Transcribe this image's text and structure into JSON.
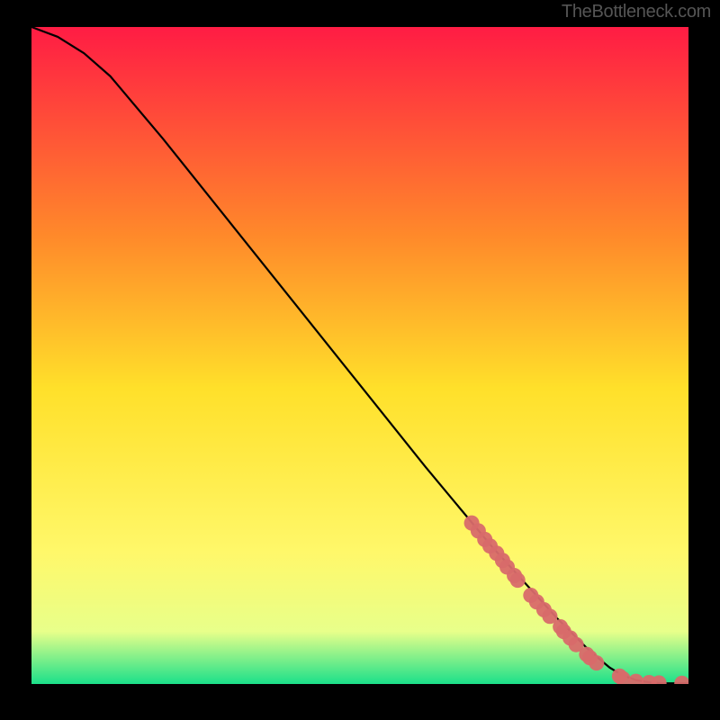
{
  "watermark": "TheBottleneck.com",
  "colors": {
    "frame": "#000000",
    "gradient_top": "#ff1c44",
    "gradient_mid1": "#ff8a2a",
    "gradient_mid2": "#ffe02a",
    "gradient_mid3": "#fff86a",
    "gradient_mid4": "#e8ff8a",
    "gradient_bot": "#1be08a",
    "curve": "#000000",
    "markers": "#d86a6a"
  },
  "chart_data": {
    "type": "line",
    "title": "",
    "xlabel": "",
    "ylabel": "",
    "xlim": [
      0,
      100
    ],
    "ylim": [
      0,
      100
    ],
    "series": [
      {
        "name": "curve",
        "x": [
          0,
          4,
          8,
          12,
          20,
          30,
          40,
          50,
          60,
          70,
          80,
          85,
          88,
          90,
          92,
          94,
          96,
          100
        ],
        "y": [
          100,
          98.5,
          96,
          92.5,
          83,
          70.5,
          58,
          45.5,
          33,
          21,
          10,
          5,
          2.5,
          1.3,
          0.6,
          0.25,
          0.1,
          0.1
        ]
      }
    ],
    "markers": [
      {
        "x": 67,
        "y": 24.5
      },
      {
        "x": 68,
        "y": 23.3
      },
      {
        "x": 69,
        "y": 22.0
      },
      {
        "x": 69.8,
        "y": 21.0
      },
      {
        "x": 70.8,
        "y": 19.9
      },
      {
        "x": 71.7,
        "y": 18.8
      },
      {
        "x": 72.4,
        "y": 17.8
      },
      {
        "x": 73.5,
        "y": 16.5
      },
      {
        "x": 74.0,
        "y": 15.8
      },
      {
        "x": 76.0,
        "y": 13.5
      },
      {
        "x": 76.9,
        "y": 12.5
      },
      {
        "x": 78.0,
        "y": 11.3
      },
      {
        "x": 78.9,
        "y": 10.3
      },
      {
        "x": 80.5,
        "y": 8.7
      },
      {
        "x": 81.0,
        "y": 8.0
      },
      {
        "x": 82.0,
        "y": 7.0
      },
      {
        "x": 82.9,
        "y": 6.0
      },
      {
        "x": 84.5,
        "y": 4.5
      },
      {
        "x": 85.0,
        "y": 4.0
      },
      {
        "x": 86.0,
        "y": 3.2
      },
      {
        "x": 89.5,
        "y": 1.2
      },
      {
        "x": 90.0,
        "y": 0.8
      },
      {
        "x": 92.0,
        "y": 0.4
      },
      {
        "x": 94.0,
        "y": 0.2
      },
      {
        "x": 95.5,
        "y": 0.15
      },
      {
        "x": 99.0,
        "y": 0.1
      }
    ]
  }
}
